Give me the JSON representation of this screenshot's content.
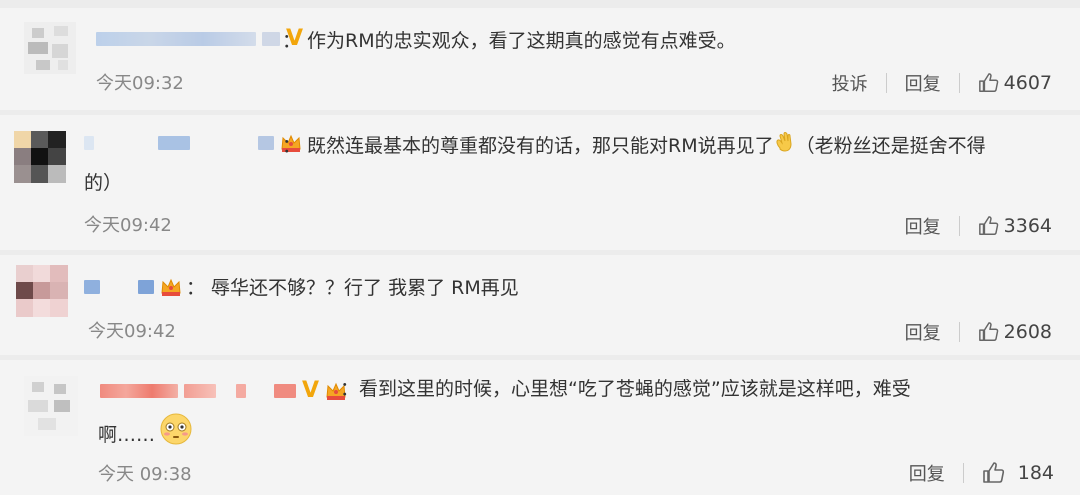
{
  "comments": [
    {
      "text": "作为RM的忠实观众，看了这期真的感觉有点难受。",
      "time": "今天09:32",
      "report": "投诉",
      "reply": "回复",
      "likes": "4607"
    },
    {
      "text_line1": "既然连最基本的尊重都没有的话，那只能对RM说再见了",
      "text_line1_tail": "（老粉丝还是挺舍不得",
      "text_line2": "的）",
      "time": "今天09:42",
      "reply": "回复",
      "likes": "3364"
    },
    {
      "text": "辱华还不够？？行了 我累了 RM再见",
      "time": "今天09:42",
      "reply": "回复",
      "likes": "2608"
    },
    {
      "text_line1": "看到这里的时候，心里想“吃了苍蝇的感觉”应该就是这样吧，难受",
      "text_line2": "啊……",
      "time": "今天 09:38",
      "reply": "回复",
      "likes": "184"
    }
  ],
  "colors": {
    "background": "#ececec",
    "card": "#f4f4f4",
    "vip_v": "#f2a60c",
    "time": "#888888"
  },
  "icons": [
    "thumbs-up-icon",
    "crown-badge-icon",
    "verified-v-icon",
    "waving-hand-emoji",
    "flushed-face-emoji"
  ]
}
